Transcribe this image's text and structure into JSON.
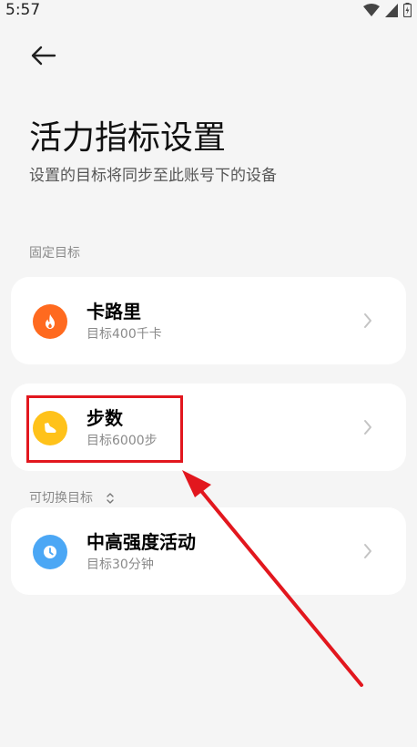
{
  "status_bar": {
    "time": "5:57"
  },
  "header": {
    "back_icon": "arrow-left-icon",
    "title": "活力指标设置",
    "subtitle": "设置的目标将同步至此账号下的设备"
  },
  "fixed_section": {
    "label": "固定目标",
    "items": [
      {
        "title": "卡路里",
        "subtitle": "目标400千卡",
        "icon": "flame-icon",
        "color": "#ff6a1f"
      },
      {
        "title": "步数",
        "subtitle": "目标6000步",
        "icon": "shoe-icon",
        "color": "#ffc21a"
      }
    ]
  },
  "switch_section": {
    "label": "可切换目标",
    "items": [
      {
        "title": "中高强度活动",
        "subtitle": "目标30分钟",
        "icon": "clock-icon",
        "color": "#4ba7f5"
      }
    ]
  },
  "annotation": {
    "color": "#e2171e"
  }
}
